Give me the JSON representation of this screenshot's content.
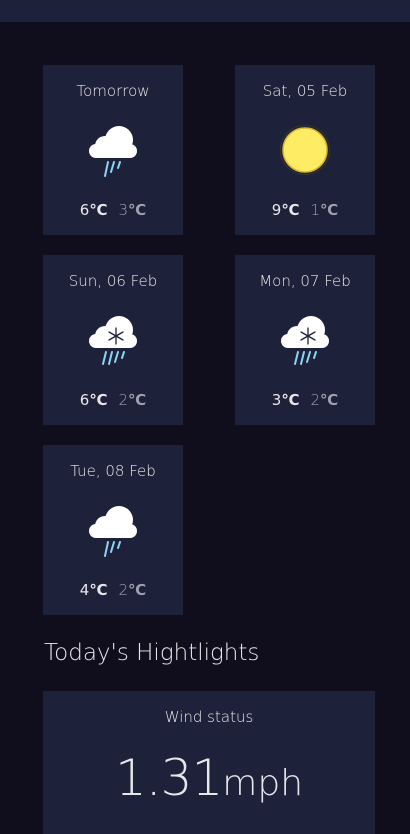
{
  "forecast": [
    {
      "day": "Tomorrow",
      "icon": "light-rain-icon",
      "max": "6",
      "min": "3",
      "unit": "℃"
    },
    {
      "day": "Sat, 05 Feb",
      "icon": "sun-icon",
      "max": "9",
      "min": "1",
      "unit": "℃"
    },
    {
      "day": "Sun, 06 Feb",
      "icon": "sleet-icon",
      "max": "6",
      "min": "2",
      "unit": "℃"
    },
    {
      "day": "Mon, 07 Feb",
      "icon": "sleet-icon",
      "max": "3",
      "min": "2",
      "unit": "℃"
    },
    {
      "day": "Tue, 08 Feb",
      "icon": "light-rain-icon",
      "max": "4",
      "min": "2",
      "unit": "℃"
    }
  ],
  "highlights": {
    "title": "Today's Hightlights",
    "wind": {
      "label": "Wind status",
      "value": "1.31",
      "unit": "mph"
    }
  },
  "colors": {
    "background": "#100e1d",
    "card": "#1e213a",
    "text": "#e7e7eb",
    "muted": "#a09fb1",
    "sun": "#ffec65"
  }
}
